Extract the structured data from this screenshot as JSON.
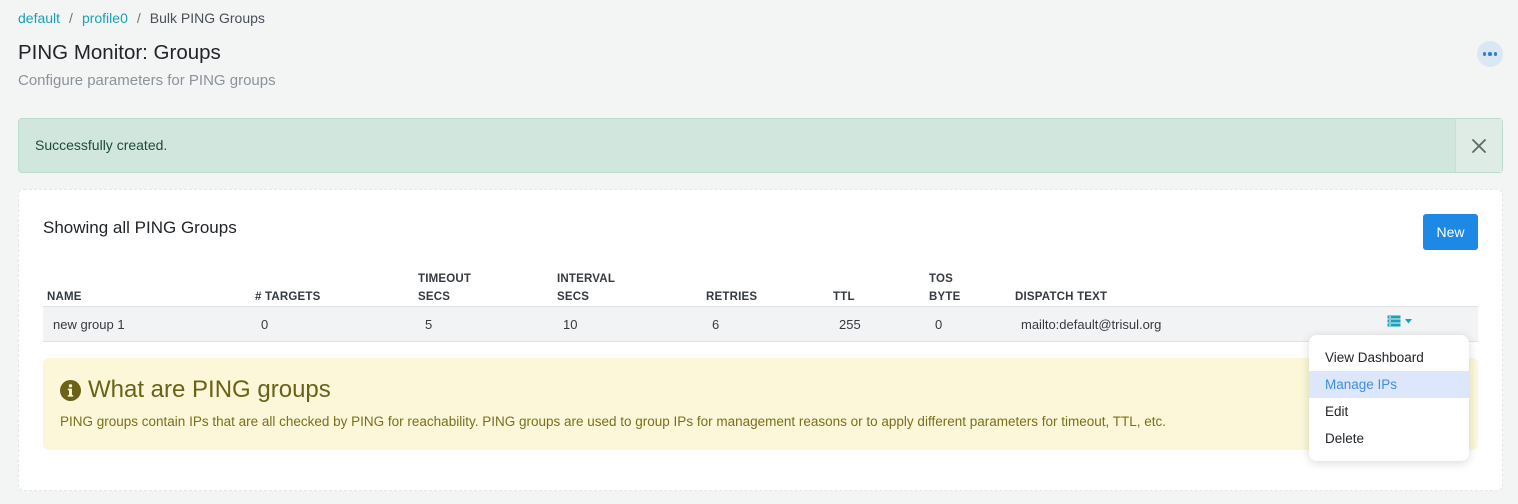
{
  "breadcrumb": {
    "items": [
      "default",
      "profile0"
    ],
    "current": "Bulk PING Groups"
  },
  "header": {
    "title": "PING Monitor: Groups",
    "subtitle": "Configure parameters for PING groups"
  },
  "alert": {
    "message": "Successfully created."
  },
  "card": {
    "title": "Showing all PING Groups",
    "new_label": "New",
    "columns": [
      [
        "NAME"
      ],
      [
        "# TARGETS"
      ],
      [
        "TIMEOUT",
        "SECS"
      ],
      [
        "INTERVAL",
        "SECS"
      ],
      [
        "RETRIES"
      ],
      [
        "TTL"
      ],
      [
        "TOS",
        "BYTE"
      ],
      [
        "DISPATCH TEXT"
      ]
    ],
    "rows": [
      {
        "name": "new group 1",
        "targets": "0",
        "timeout": "5",
        "interval": "10",
        "retries": "6",
        "ttl": "255",
        "tos": "0",
        "dispatch": "mailto:default@trisul.org"
      }
    ]
  },
  "info": {
    "title": "What are PING groups",
    "text": "PING groups contain IPs that are all checked by PING for reachability. PING groups are used to group IPs for management reasons or to apply different parameters for timeout, TTL, etc."
  },
  "dropdown": {
    "items": [
      "View Dashboard",
      "Manage IPs",
      "Edit",
      "Delete"
    ],
    "active_index": 1
  },
  "colors": {
    "link": "#17a2b8",
    "primary": "#1e88e5",
    "alert_bg": "#d1e7dd",
    "info_bg": "#fbf7d8",
    "row_icon": "#17a2b8"
  },
  "icons": {
    "more": "ellipsis-icon",
    "close": "close-icon",
    "row_action": "server-list-icon",
    "info": "info-circle-icon"
  }
}
